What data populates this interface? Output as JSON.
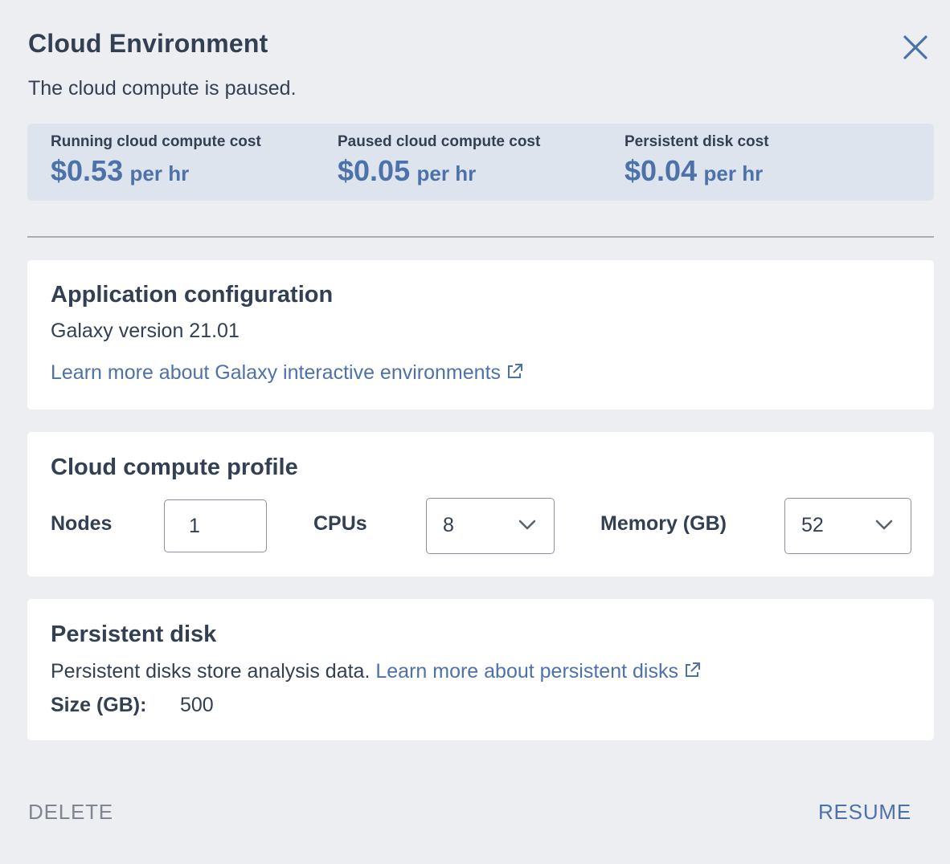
{
  "header": {
    "title": "Cloud Environment",
    "status_text": "The cloud compute is paused."
  },
  "costs": [
    {
      "label": "Running cloud compute cost",
      "amount": "$0.53",
      "unit": "per hr"
    },
    {
      "label": "Paused cloud compute cost",
      "amount": "$0.05",
      "unit": "per hr"
    },
    {
      "label": "Persistent disk cost",
      "amount": "$0.04",
      "unit": "per hr"
    }
  ],
  "app_config": {
    "title": "Application configuration",
    "version_text": "Galaxy version 21.01",
    "learn_more_link": "Learn more about Galaxy interactive environments"
  },
  "compute_profile": {
    "title": "Cloud compute profile",
    "nodes_label": "Nodes",
    "nodes_value": "1",
    "cpus_label": "CPUs",
    "cpus_value": "8",
    "memory_label": "Memory (GB)",
    "memory_value": "52"
  },
  "persistent_disk": {
    "title": "Persistent disk",
    "description": "Persistent disks store analysis data.",
    "learn_more_link": "Learn more about persistent disks",
    "size_label": "Size (GB):",
    "size_value": "500"
  },
  "footer": {
    "delete_label": "DELETE",
    "resume_label": "RESUME"
  },
  "colors": {
    "accent": "#4d72aa",
    "text": "#333f52",
    "banner_bg": "#dde4ee",
    "panel_bg": "#eceef1"
  },
  "icons": {
    "close": "close-icon",
    "external_link": "external-link-icon",
    "dropdown": "chevron-down-icon"
  }
}
